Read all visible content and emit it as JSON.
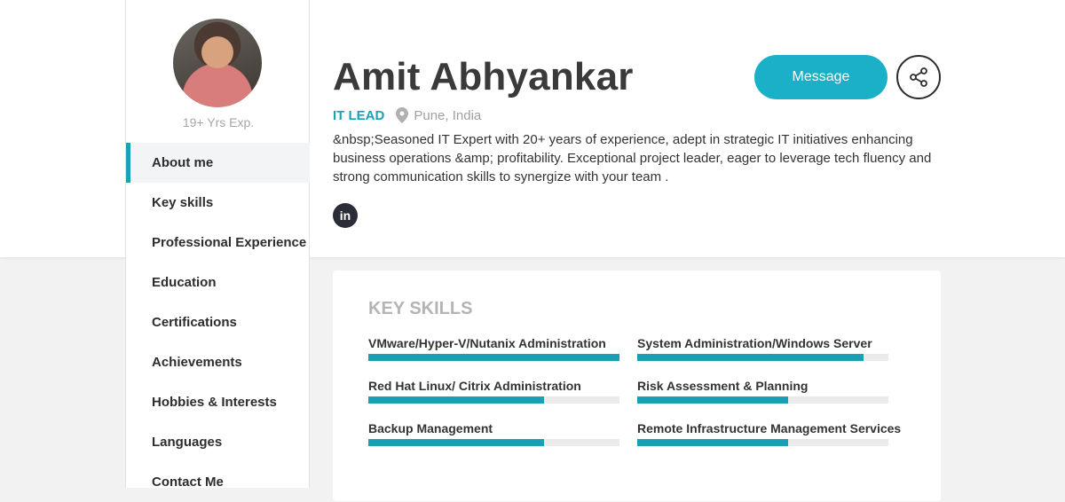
{
  "profile": {
    "name": "Amit Abhyankar",
    "role": "IT LEAD",
    "location": "Pune, India",
    "experience": "19+ Yrs Exp.",
    "about": "&nbsp;Seasoned IT Expert with 20+ years of experience, adept in strategic IT initiatives enhancing business operations &amp; profitability. Exceptional project leader, eager to leverage tech fluency and strong communication skills to synergize with your team ."
  },
  "actions": {
    "message_label": "Message",
    "linkedin_label": "in"
  },
  "nav": {
    "items": [
      {
        "label": "About me",
        "active": true
      },
      {
        "label": "Key skills"
      },
      {
        "label": "Professional Experience"
      },
      {
        "label": "Education"
      },
      {
        "label": "Certifications"
      },
      {
        "label": "Achievements"
      },
      {
        "label": "Hobbies & Interests"
      },
      {
        "label": "Languages"
      },
      {
        "label": "Contact Me"
      }
    ]
  },
  "key_skills": {
    "title": "KEY SKILLS",
    "items": [
      {
        "label": "VMware/Hyper-V/Nutanix Administration",
        "level": 1.0
      },
      {
        "label": "System Administration/Windows Server",
        "level": 0.9
      },
      {
        "label": "Red Hat Linux/ Citrix Administration",
        "level": 0.7
      },
      {
        "label": "Risk Assessment & Planning",
        "level": 0.6
      },
      {
        "label": "Backup Management",
        "level": 0.7
      },
      {
        "label": "Remote Infrastructure Management Services",
        "level": 0.6
      }
    ]
  },
  "colors": {
    "accent": "#17a2b8",
    "button": "#1ab0c8",
    "text": "#2b2b2b"
  },
  "icons": [
    "location-pin-icon",
    "share-icon",
    "linkedin-icon"
  ]
}
